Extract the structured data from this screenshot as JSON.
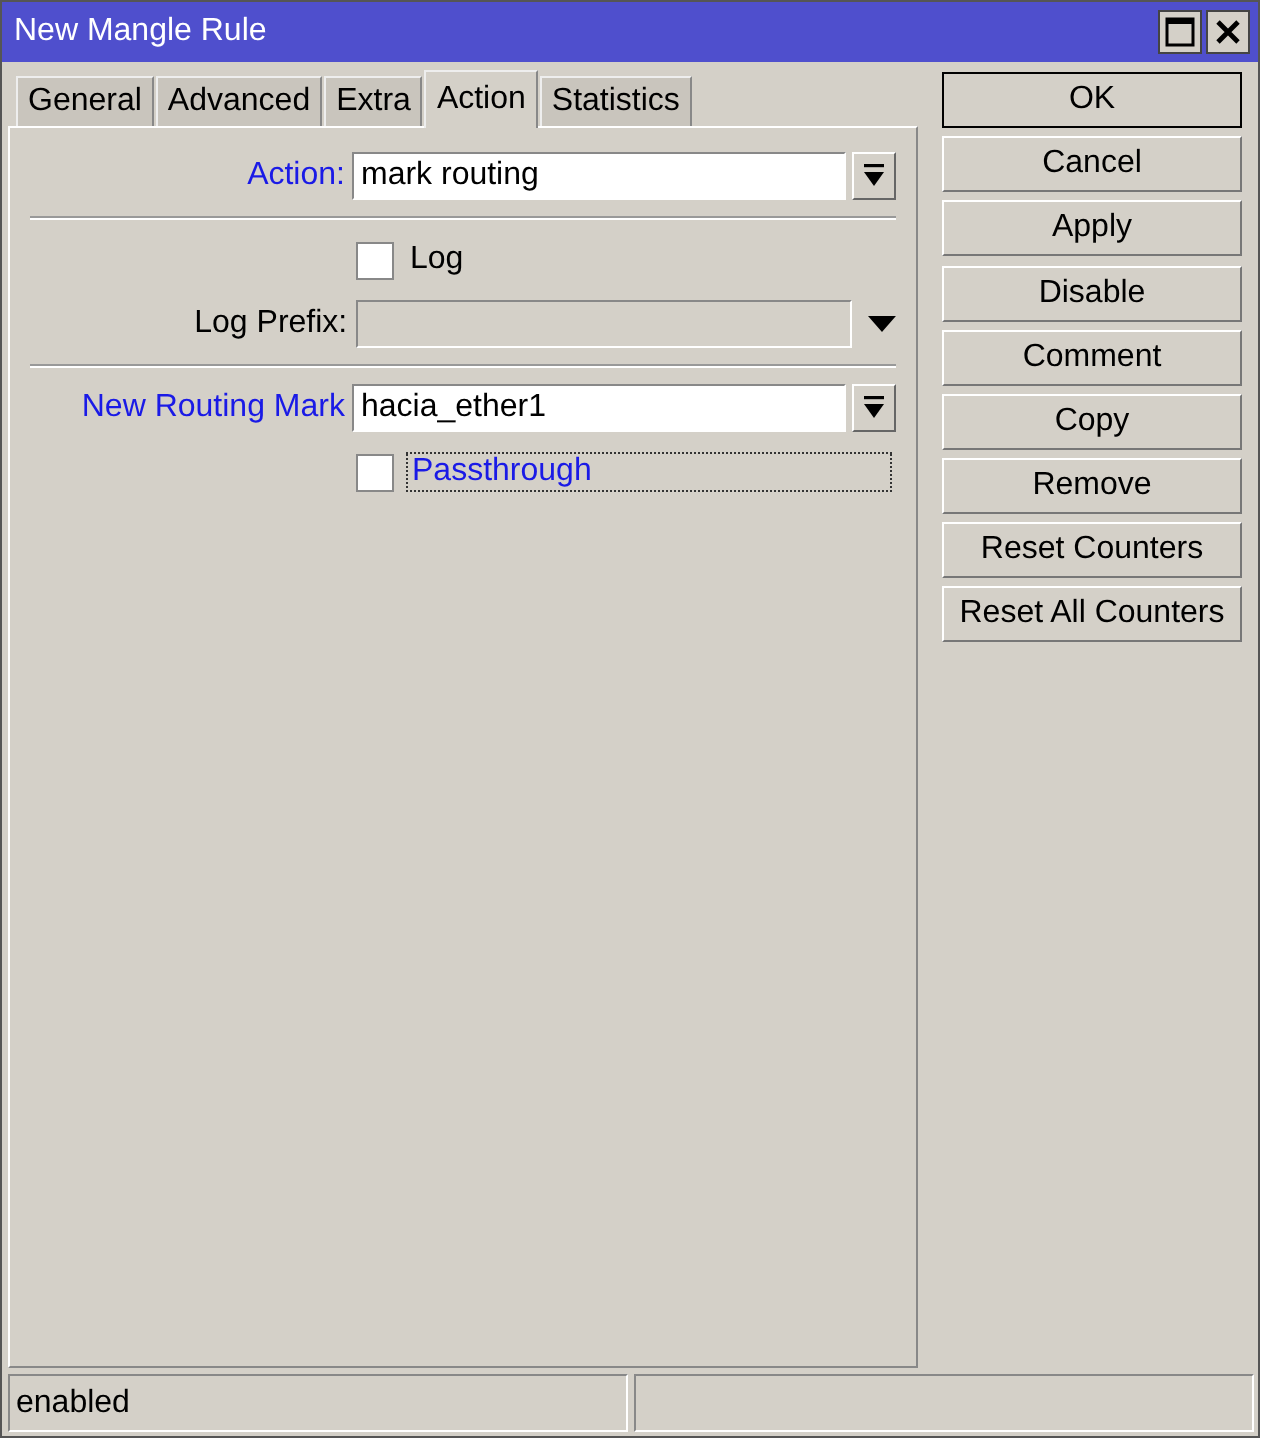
{
  "window": {
    "title": "New Mangle Rule"
  },
  "tabs": [
    {
      "label": "General",
      "selected": false
    },
    {
      "label": "Advanced",
      "selected": false
    },
    {
      "label": "Extra",
      "selected": false
    },
    {
      "label": "Action",
      "selected": true
    },
    {
      "label": "Statistics",
      "selected": false
    }
  ],
  "form": [
    {
      "kind": "select",
      "label": "Action:",
      "highlighted": true,
      "value": "mark routing"
    },
    {
      "kind": "separator"
    },
    {
      "kind": "checkbox",
      "label": "Log",
      "highlighted": false,
      "checked": false,
      "focused": false
    },
    {
      "kind": "input",
      "label": "Log Prefix:",
      "highlighted": false,
      "disabled": true
    },
    {
      "kind": "separator"
    },
    {
      "kind": "select",
      "label": "New Routing Mark",
      "highlighted": true,
      "value": "hacia_ether1"
    },
    {
      "kind": "checkbox",
      "label": "Passthrough",
      "highlighted": true,
      "checked": false,
      "focused": true
    }
  ],
  "button_groups": [
    [
      {
        "label": "OK",
        "default": true
      },
      {
        "label": "Cancel",
        "default": false
      },
      {
        "label": "Apply",
        "default": false
      }
    ],
    [
      {
        "label": "Disable",
        "default": false
      },
      {
        "label": "Comment",
        "default": false
      },
      {
        "label": "Copy",
        "default": false
      },
      {
        "label": "Remove",
        "default": false
      },
      {
        "label": "Reset Counters",
        "default": false
      },
      {
        "label": "Reset All Counters",
        "default": false
      }
    ]
  ],
  "status_bar": {
    "text": "enabled"
  }
}
